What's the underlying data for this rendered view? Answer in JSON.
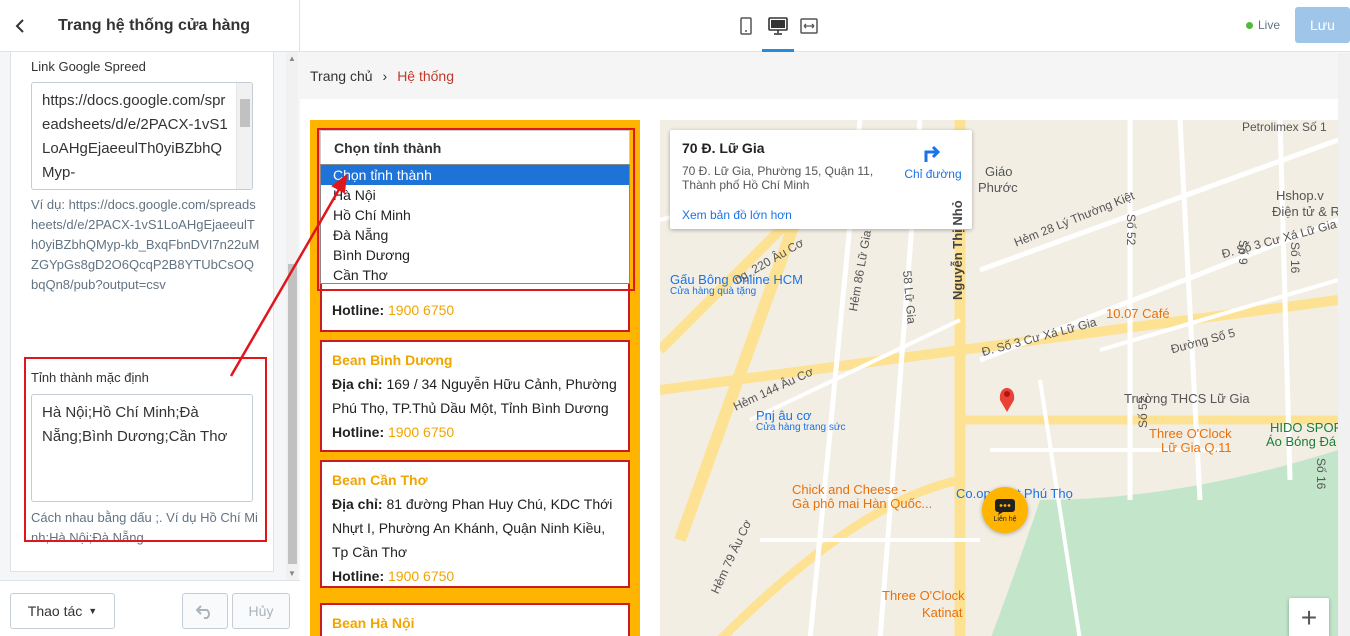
{
  "panel": {
    "title": "Trang hệ thống cửa hàng",
    "google_label": "Link Google Spreed",
    "google_value": "https://docs.google.com/spreadsheets/d/e/2PACX-1vS1LoAHgEjaeeulTh0yiBZbhQMyp-",
    "google_hint": "Ví dụ: https://docs.google.com/spreadsheets/d/e/2PACX-1vS1LoAHgEjaeeulTh0yiBZbhQMyp-kb_BxqFbnDVI7n22uMZGYpGs8gD2O6QcqP2B8YTUbCsOQbqQn8/pub?output=csv",
    "province_label": "Tỉnh thành mặc định",
    "province_value": "Hà Nội;Hồ Chí Minh;Đà Nẵng;Bình Dương;Cần Thơ",
    "province_hint": "Cách nhau bằng dấu ;. Ví dụ Hồ Chí Minh;Hà Nội;Đà Nẵng",
    "actions_label": "Thao tác",
    "undo_icon": "undo-icon",
    "cancel_label": "Hủy"
  },
  "topbar": {
    "live_label": "Live",
    "save_label": "Lưu",
    "devices": [
      "mobile-icon",
      "desktop-icon",
      "fullwidth-icon"
    ],
    "accent": "#2b8ad8"
  },
  "breadcrumb": {
    "home": "Trang chủ",
    "current": "Hệ thống"
  },
  "selector": {
    "value": "Chọn tỉnh thành",
    "options": [
      "Chọn tỉnh thành",
      "Hà Nội",
      "Hồ Chí Minh",
      "Đà Nẵng",
      "Bình Dương",
      "Cần Thơ"
    ]
  },
  "stores": {
    "partial_hotline_label": "Hotline:",
    "partial_hotline": "1900 6750",
    "items": [
      {
        "name": "Bean Bình Dương",
        "address_label": "Địa chỉ:",
        "address": "169 / 34 Nguyễn Hữu Cảnh, Phường Phú Thọ, TP.Thủ Dầu Một, Tỉnh Bình Dương",
        "hotline_label": "Hotline:",
        "hotline": "1900 6750"
      },
      {
        "name": "Bean Cần Thơ",
        "address_label": "Địa chỉ:",
        "address": "81 đường Phan Huy Chú, KDC Thới Nhựt I, Phường An Khánh, Quận Ninh Kiều, Tp Cần Thơ",
        "hotline_label": "Hotline:",
        "hotline": "1900 6750"
      },
      {
        "name": "Bean Hà Nội"
      }
    ]
  },
  "map": {
    "title": "70 Đ. Lữ Gia",
    "address": "70 Đ. Lữ Gia, Phường 15, Quận 11, Thành phố Hồ Chí Minh",
    "directions": "Chỉ đường",
    "bigger_map": "Xem bản đồ lớn hơn",
    "labels": [
      "Petrolimex Số 1",
      "Hshop.v",
      "Điện tử & Rol",
      "Gấu Bông Online HCM",
      "Cửa hàng quà tặng",
      "Nguyễn Thị Nhỏ",
      "Đ. Số 3 Cư Xá Lữ Gia",
      "10.07 Café",
      "Đường Số 5",
      "Trường THCS Lữ Gia",
      "Pnj âu cơ",
      "Cửa hàng trang sức",
      "Three O'Clock",
      "Lữ Gia Q.11",
      "HIDO SPORT - Sỉ",
      "Áo Bóng Đá - Sỉ",
      "Co.op Mart Phú Thọ",
      "Chick and Cheese -",
      "Gà phô mai Hàn Quốc...",
      "Three O'Clock",
      "Katinat",
      "Hẻm 28 Lý Thường Kiệt",
      "Hẻm 144 Âu Cơ",
      "Hẻm 79 Âu Cơ",
      "Hẻm 86 Lữ Gia",
      "58 Lữ Gia",
      "Số 52",
      "Số 16",
      "Đ. Số 3 Cư Xá Lữ Gia",
      "Số 52",
      "Số 16",
      "Số 9",
      "Giáo",
      "Phước",
      "ng. 220 Âu Cơ"
    ],
    "zoom_in": "+",
    "chat_label": "Liên hệ",
    "land": "#f3eee4",
    "road": "#ffffff",
    "major_road": "#fde293",
    "park": "#c3e6cb",
    "pin": "#ea4335"
  },
  "annotation_color": "#e0161d"
}
